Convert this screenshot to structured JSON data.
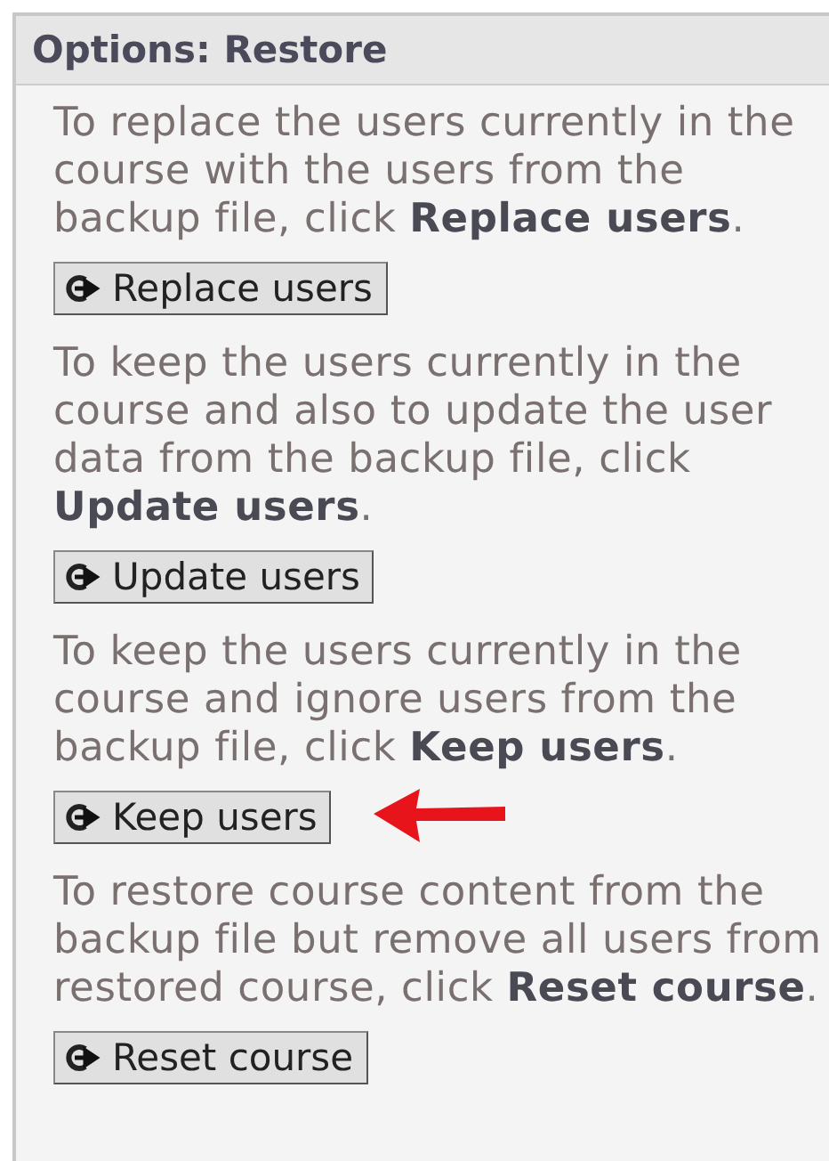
{
  "panel": {
    "title": "Options: Restore"
  },
  "options": [
    {
      "description": "To replace the users currently in the course with the users from the backup file, click **Replace users**.",
      "button": "Replace users",
      "highlighted": false
    },
    {
      "description": "To keep the users currently in the course and also to update the user data from the backup file, click **Update users**.",
      "button": "Update users",
      "highlighted": false
    },
    {
      "description": "To keep the users currently in the course and ignore users from the backup file, click **Keep users**.",
      "button": "Keep users",
      "highlighted": true
    },
    {
      "description": "To restore course content from the backup file but remove all users from restored course, click **Reset course**.",
      "button": "Reset course",
      "highlighted": false
    }
  ]
}
